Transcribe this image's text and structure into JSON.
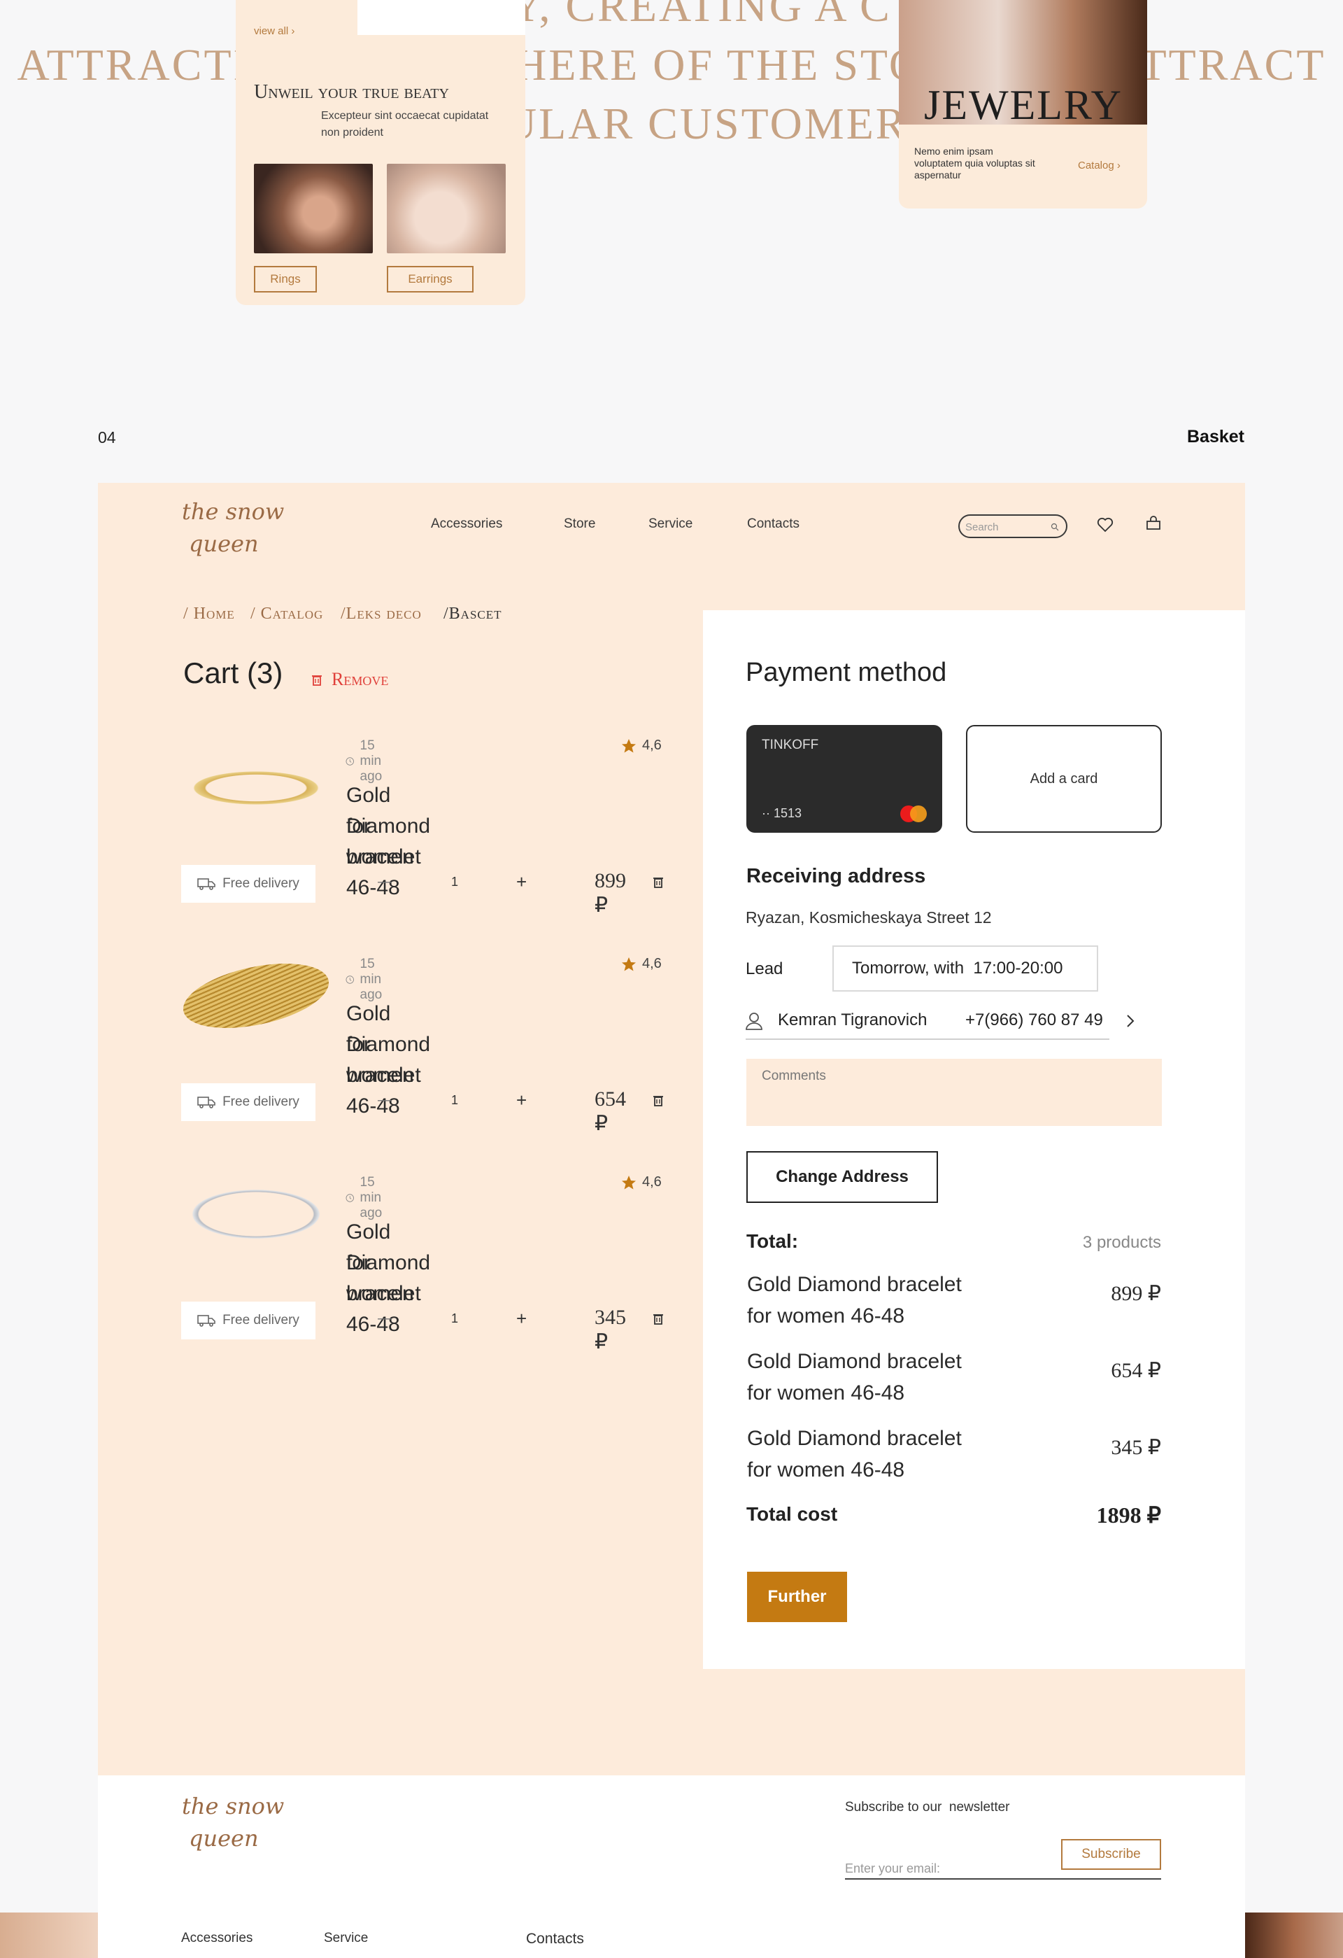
{
  "top_preview": {
    "bg_line1": "ERY, CREATING A C",
    "bg_line2": "ATTRACTIVE ATMOSPHERE OF THE STORE AND ATTRACT",
    "bg_line3": "REGULAR CUSTOMERS",
    "left_card": {
      "view_all": "view all ›",
      "heading": "Unweil your true beaty",
      "text": "Excepteur sint occaecat cupidatat non proident",
      "btn_rings": "Rings",
      "btn_earrings": "Earrings"
    },
    "right_card": {
      "jewelry": "JEWELRY",
      "text": "Nemo enim ipsam voluptatem quia voluptas sit aspernatur",
      "catalog": "Catalog ›"
    }
  },
  "section": {
    "number": "04",
    "title": "Basket"
  },
  "header": {
    "logo_line1": "the snow",
    "logo_line2": "queen",
    "nav": [
      "Accessories",
      "Store",
      "Service",
      "Contacts"
    ],
    "search_placeholder": "Search"
  },
  "breadcrumb": [
    "/ Home",
    "/ Catalog",
    "/Leks deco",
    "/Bascet"
  ],
  "cart": {
    "title": "Cart (3)",
    "remove": "Remove",
    "items": [
      {
        "time": "15 min ago",
        "rating": "4,6",
        "title1": "Gold Diamond bracelet",
        "title2": "for women 46-48",
        "delivery": "Free delivery",
        "minus": "—",
        "qty": "1",
        "plus": "+",
        "price": "899 ₽"
      },
      {
        "time": "15 min ago",
        "rating": "4,6",
        "title1": "Gold Diamond bracelet",
        "title2": "for women 46-48",
        "delivery": "Free delivery",
        "minus": "—",
        "qty": "1",
        "plus": "+",
        "price": "654 ₽"
      },
      {
        "time": "15 min ago",
        "rating": "4,6",
        "title1": "Gold Diamond bracelet",
        "title2": "for women 46-48",
        "delivery": "Free delivery",
        "minus": "—",
        "qty": "1",
        "plus": "+",
        "price": "345 ₽"
      }
    ]
  },
  "payment": {
    "title": "Payment method",
    "card_bank": "TINKOFF",
    "card_number": "·· 1513",
    "add_card": "Add a card",
    "address_title": "Receiving address",
    "address": "Ryazan, Kosmicheskaya Street 12",
    "lead_label": "Lead",
    "lead_value": "Tomorrow, with  17:00-20:00",
    "contact_name": "Kemran Tigranovich",
    "contact_phone": "+7(966) 760 87 49",
    "comments_placeholder": "Comments",
    "change_address": "Change Address",
    "total_label": "Total:",
    "total_count": "3 products",
    "lines": [
      {
        "title1": "Gold Diamond bracelet",
        "title2": "for women 46-48",
        "price": "899 ₽"
      },
      {
        "title1": "Gold Diamond bracelet",
        "title2": "for women 46-48",
        "price": "654 ₽"
      },
      {
        "title1": "Gold Diamond bracelet",
        "title2": "for women 46-48",
        "price": "345 ₽"
      }
    ],
    "total_cost_label": "Total cost",
    "total_cost": "1898 ₽",
    "further": "Further"
  },
  "footer": {
    "logo_line1": "the snow",
    "logo_line2": "queen",
    "newsletter": "Subscribe to our  newsletter",
    "email_placeholder": "Enter your email:",
    "subscribe": "Subscribe",
    "links": [
      "Accessories",
      "Service",
      "Contacts"
    ]
  },
  "colors": {
    "accent": "#c47a12",
    "peach": "#fdebdb",
    "dark_card": "#2b2b2b",
    "remove": "#e0403a"
  }
}
